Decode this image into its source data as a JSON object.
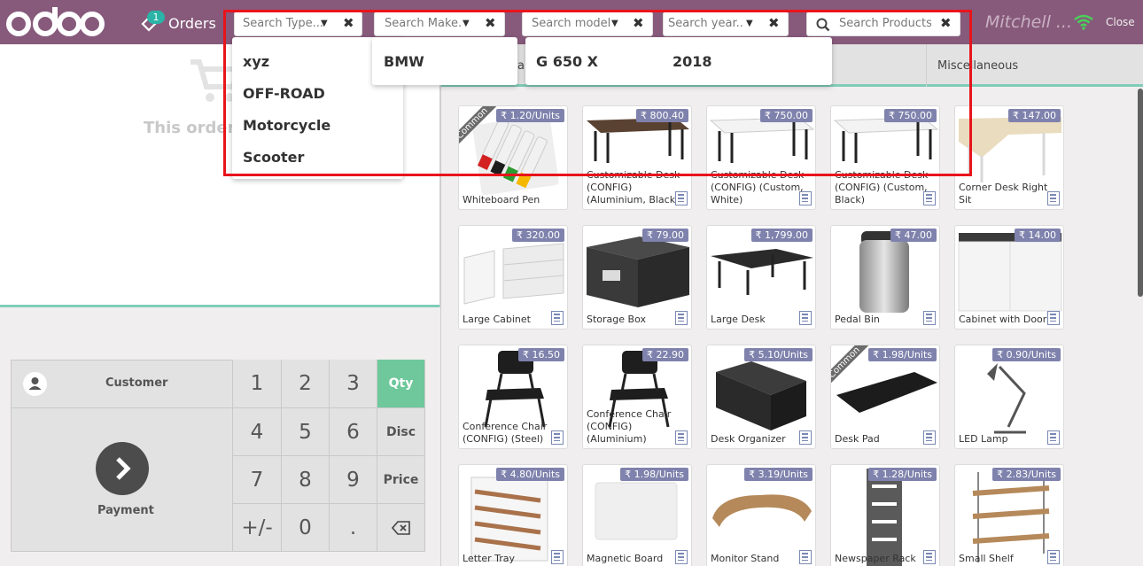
{
  "header": {
    "brand": "odoo",
    "orders_label": "Orders",
    "orders_count": "1",
    "user_name": "Mitchell ...",
    "close_label": "Close",
    "search_type": {
      "placeholder": "Search Type..."
    },
    "search_make": {
      "placeholder": "Search Make.."
    },
    "search_model": {
      "placeholder": "Search model."
    },
    "search_year": {
      "placeholder": "Search year..."
    },
    "search_products": {
      "placeholder": "Search Products."
    }
  },
  "dropdowns": {
    "type_options": [
      "xyz",
      "OFF-ROAD",
      "Motorcycle",
      "Scooter"
    ],
    "make_options": [
      "BMW"
    ],
    "model_options": [
      "G 650 X"
    ],
    "year_options": [
      "2018"
    ]
  },
  "order": {
    "empty_text": "This orderi"
  },
  "numpad": {
    "customer_label": "Customer",
    "payment_label": "Payment",
    "keys": [
      "1",
      "2",
      "3",
      "4",
      "5",
      "6",
      "7",
      "8",
      "9",
      "+/-",
      "0",
      "."
    ],
    "modes": [
      "Qty",
      "Disc",
      "Price"
    ]
  },
  "categories": {
    "partial_label": "ai",
    "misc_label": "Miscellaneous"
  },
  "products": [
    {
      "name": "Whiteboard Pen",
      "price": "₹ 1.20/Units",
      "ribbon": "Common",
      "config": false
    },
    {
      "name": "Customizable Desk (CONFIG) (Aluminium, Black)",
      "price": "₹ 800.40",
      "config": true
    },
    {
      "name": "Customizable Desk (CONFIG) (Custom, White)",
      "price": "₹ 750.00",
      "config": true
    },
    {
      "name": "Customizable Desk (CONFIG) (Custom, Black)",
      "price": "₹ 750.00",
      "config": true
    },
    {
      "name": "Corner Desk Right Sit",
      "price": "₹ 147.00",
      "config": true
    },
    {
      "name": "Large Cabinet",
      "price": "₹ 320.00",
      "config": true
    },
    {
      "name": "Storage Box",
      "price": "₹ 79.00",
      "config": true
    },
    {
      "name": "Large Desk",
      "price": "₹ 1,799.00",
      "config": true
    },
    {
      "name": "Pedal Bin",
      "price": "₹ 47.00",
      "config": true
    },
    {
      "name": "Cabinet with Doors",
      "price": "₹ 14.00",
      "config": true
    },
    {
      "name": "Conference Chair (CONFIG) (Steel)",
      "price": "₹ 16.50",
      "config": true
    },
    {
      "name": "Conference Chair (CONFIG) (Aluminium)",
      "price": "₹ 22.90",
      "config": true
    },
    {
      "name": "Desk Organizer",
      "price": "₹ 5.10/Units",
      "config": true
    },
    {
      "name": "Desk Pad",
      "price": "₹ 1.98/Units",
      "ribbon": "Common",
      "config": true
    },
    {
      "name": "LED Lamp",
      "price": "₹ 0.90/Units",
      "config": true
    },
    {
      "name": "Letter Tray",
      "price": "₹ 4.80/Units",
      "config": true
    },
    {
      "name": "Magnetic Board",
      "price": "₹ 1.98/Units",
      "config": true
    },
    {
      "name": "Monitor Stand",
      "price": "₹ 3.19/Units",
      "config": true
    },
    {
      "name": "Newspaper Rack",
      "price": "₹ 1.28/Units",
      "config": true
    },
    {
      "name": "Small Shelf",
      "price": "₹ 2.83/Units",
      "config": true
    }
  ],
  "colors": {
    "header": "#875a7b",
    "accent": "#6ec89b",
    "price_tag": "#7f82ac",
    "highlight": "#e8141b"
  }
}
